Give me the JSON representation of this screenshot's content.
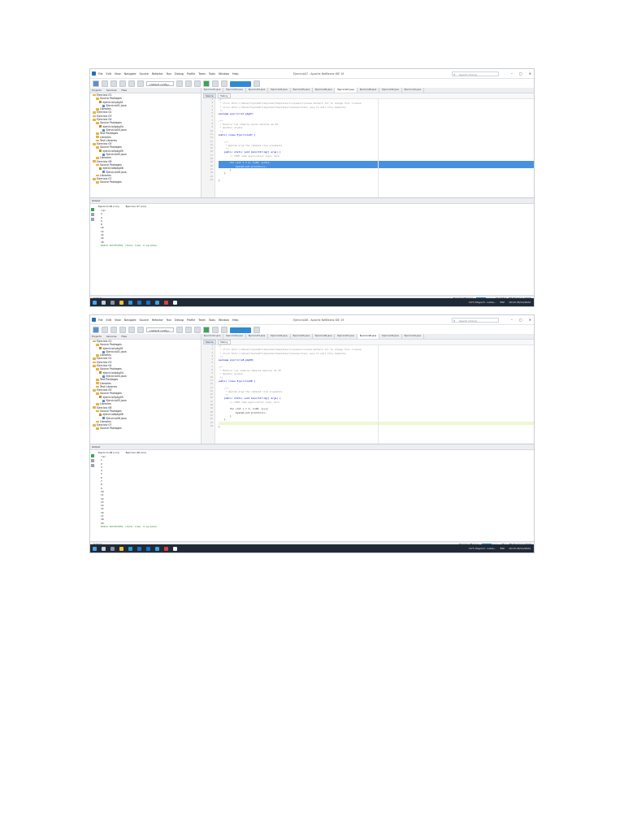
{
  "menu": [
    "File",
    "Edit",
    "View",
    "Navigate",
    "Source",
    "Refactor",
    "Run",
    "Debug",
    "Profile",
    "Team",
    "Tools",
    "Window",
    "Help"
  ],
  "search_placeholder": "Search (Ctrl+I)",
  "config_select": "<default config>",
  "panel_tabs": [
    "Projects",
    "Services",
    "Files"
  ],
  "project_tree": [
    "Ejercicio 01",
    "Source Packages",
    "ejercicio1pkg01",
    "Ejercicio01.java",
    "Libraries",
    "Ejercicio 02",
    "Ejercicio 03",
    "Ejercicio 04",
    "Source Packages",
    "ejercicio4pkg04",
    "Ejercicio04.java",
    "Test Packages",
    "Libraries",
    "Test Libraries",
    "Ejercicio 05",
    "Source Packages",
    "ejercicio5pkg05",
    "Ejercicio05.java",
    "Libraries",
    "Ejercicio 06",
    "Source Packages",
    "ejercicio6pkg06",
    "Ejercicio06.java",
    "Libraries",
    "Ejercicio 07",
    "Source Packages"
  ],
  "editor_modes": [
    "Source",
    "History"
  ],
  "file_tabs": [
    "Ejercicio01.java",
    "Ejercicio02.java",
    "Ejercicio03.java",
    "Ejercicio04.java",
    "Ejercicio05.java",
    "Ejercicio06.java",
    "Ejercicio07.java",
    "Ejercicio08.java",
    "Ejercicio09.java",
    "Ejercicio10.java"
  ],
  "statusbar_left": "Output",
  "shots": [
    {
      "window_title": "Ejercicio07 - Apache NetBeans IDE 19",
      "code_lines": [
        "/*",
        " * Click nbfs://nbhost/SystemFileSystem/Templates/Licenses/license-default.txt to change this license",
        " * Click nbfs://nbhost/SystemFileSystem/Templates/Classes/Class.java to edit this template",
        " */",
        "package ejercicio7.pkg07;",
        "",
        "/**",
        " * Mostrar los números pares menores de 20",
        " * @author alumno",
        " */",
        "public class Ejercicio07 {",
        "",
        "    /**",
        "     * @param args the command line arguments",
        "     */",
        "    public static void main(String[] args) {",
        "        // TODO code application logic here",
        "",
        "        for (int i = 2; i<20; i+=2){",
        "            System.out.println(i);",
        "        }",
        "    }",
        "",
        "}"
      ],
      "output_title": "Output",
      "output_tabs": [
        "Ejercicio 06 (run)",
        "Ejercicio 07 (run)"
      ],
      "output_lines": [
        "run:",
        "2",
        "4",
        "6",
        "8",
        "10",
        "12",
        "14",
        "16",
        "18",
        "BUILD SUCCESSFUL (total time: 0 seconds)"
      ],
      "status_right": "Ejercicio 06 (run)",
      "cursor": "20:13/3:0",
      "ins": "INS Windows (CRLF)",
      "time": "10:16",
      "date": "25/11/2024",
      "weather": "10°C Mayorm. nubla...",
      "lang": "ESP"
    },
    {
      "window_title": "Ejercicio08 - Apache NetBeans IDE 19",
      "code_lines": [
        "/*",
        " * Click nbfs://nbhost/SystemFileSystem/Templates/Licenses/license-default.txt to change this license",
        " * Click nbfs://nbhost/SystemFileSystem/Templates/Classes/Class.java to edit this template",
        " */",
        "package ejercicio8.pkg08;",
        "",
        "/**",
        " * Mostrar los números impares menores de 20",
        " * @author alumno",
        " */",
        "public class Ejercicio08 {",
        "",
        "    /**",
        "     * @param args the command line arguments",
        "     */",
        "    public static void main(String[] args) {",
        "        // TODO code application logic here",
        "",
        "        for (int i = 1; i<20; i++){",
        "            System.out.println(i);",
        "        }",
        "    }",
        "",
        "}"
      ],
      "output_title": "Output",
      "output_tabs": [
        "Ejercicio 08 (run)",
        "Ejercicio 08 (run)"
      ],
      "output_lines": [
        "run:",
        "1",
        "2",
        "3",
        "4",
        "5",
        "6",
        "7",
        "8",
        "9",
        "10",
        "11",
        "12",
        "13",
        "14",
        "15",
        "16",
        "17",
        "18",
        "19",
        "BUILD SUCCESSFUL (total time: 0 seconds)"
      ],
      "status_right": "Ejercicio 08 (run)",
      "cursor": "23:1",
      "ins": "INS Windows (CRLF)",
      "time": "10:16",
      "date": "25/11/2024",
      "weather": "10°C Mayorm. nubla...",
      "lang": "ESP"
    }
  ]
}
